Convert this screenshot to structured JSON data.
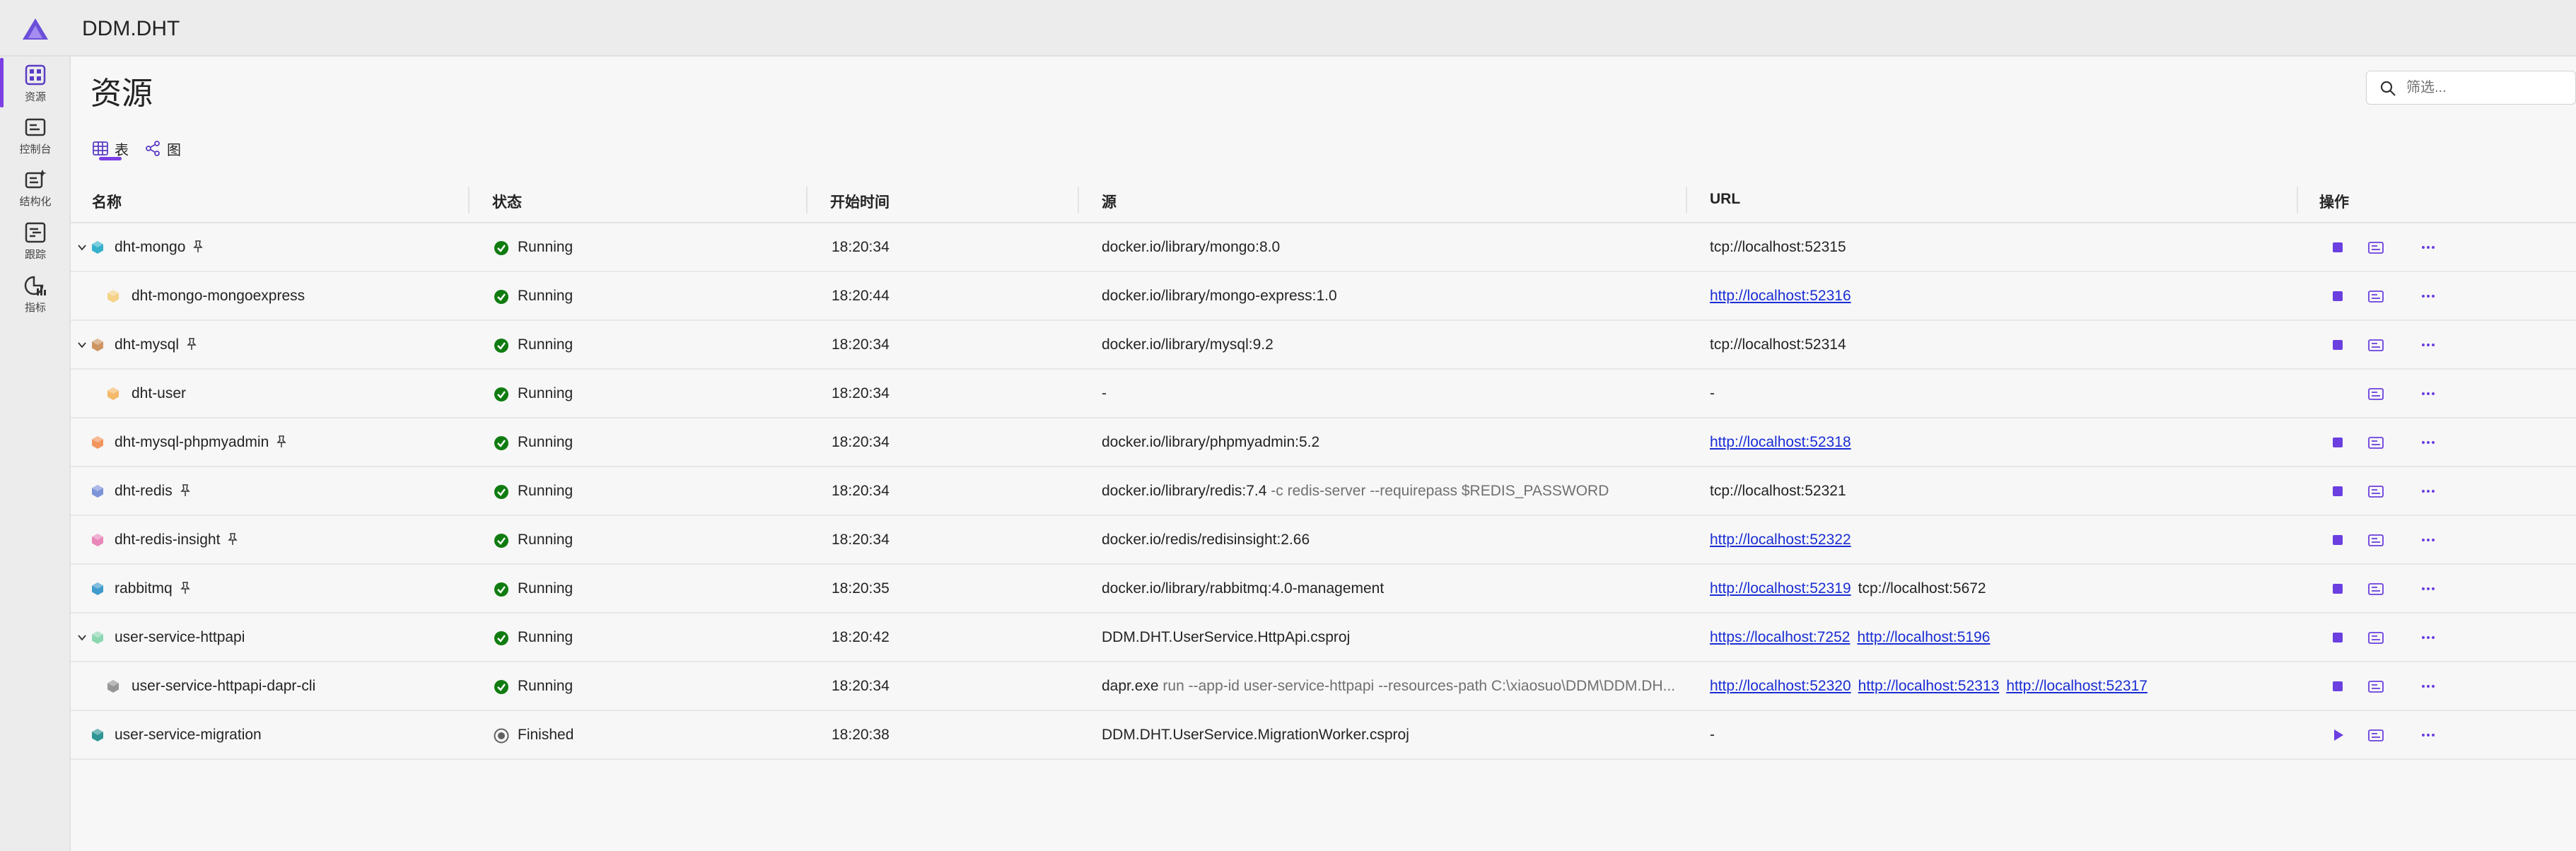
{
  "app": {
    "title": "DDM.DHT"
  },
  "sidebar": {
    "items": [
      {
        "label": "资源",
        "icon": "resources-grid-icon",
        "active": true
      },
      {
        "label": "控制台",
        "icon": "console-icon",
        "active": false
      },
      {
        "label": "结构化",
        "icon": "structured-logs-icon",
        "active": false
      },
      {
        "label": "跟踪",
        "icon": "traces-icon",
        "active": false
      },
      {
        "label": "指标",
        "icon": "metrics-icon",
        "active": false
      }
    ]
  },
  "page": {
    "title": "资源"
  },
  "filter": {
    "placeholder": "筛选..."
  },
  "view_tabs": [
    {
      "label": "表",
      "active": true
    },
    {
      "label": "图",
      "active": false
    }
  ],
  "table": {
    "columns": [
      "名称",
      "状态",
      "开始时间",
      "源",
      "URL",
      "操作"
    ],
    "rows": [
      {
        "name": "dht-mongo",
        "expandable": true,
        "child": false,
        "pinned": true,
        "icon_color": "#1fa9c7",
        "status": "Running",
        "start": "18:20:34",
        "source": "docker.io/library/mongo:8.0",
        "source_args": "",
        "urls": [
          {
            "text": "tcp://localhost:52315",
            "link": false
          }
        ],
        "stop": true
      },
      {
        "name": "dht-mongo-mongoexpress",
        "expandable": false,
        "child": true,
        "pinned": false,
        "icon_color": "#f3cd7a",
        "status": "Running",
        "start": "18:20:44",
        "source": "docker.io/library/mongo-express:1.0",
        "source_args": "",
        "urls": [
          {
            "text": "http://localhost:52316",
            "link": true
          }
        ],
        "stop": true
      },
      {
        "name": "dht-mysql",
        "expandable": true,
        "child": false,
        "pinned": true,
        "icon_color": "#c98a52",
        "status": "Running",
        "start": "18:20:34",
        "source": "docker.io/library/mysql:9.2",
        "source_args": "",
        "urls": [
          {
            "text": "tcp://localhost:52314",
            "link": false
          }
        ],
        "stop": true
      },
      {
        "name": "dht-user",
        "expandable": false,
        "child": true,
        "pinned": false,
        "icon_color": "#f3b25a",
        "status": "Running",
        "start": "18:20:34",
        "source": "-",
        "source_args": "",
        "urls": [
          {
            "text": "-",
            "link": false
          }
        ],
        "stop": false
      },
      {
        "name": "dht-mysql-phpmyadmin",
        "expandable": false,
        "child": false,
        "pinned": true,
        "icon_color": "#f08a4b",
        "status": "Running",
        "start": "18:20:34",
        "source": "docker.io/library/phpmyadmin:5.2",
        "source_args": "",
        "urls": [
          {
            "text": "http://localhost:52318",
            "link": true
          }
        ],
        "stop": true
      },
      {
        "name": "dht-redis",
        "expandable": false,
        "child": false,
        "pinned": true,
        "icon_color": "#6f88d6",
        "status": "Running",
        "start": "18:20:34",
        "source": "docker.io/library/redis:7.4",
        "source_args": "-c redis-server --requirepass $REDIS_PASSWORD",
        "urls": [
          {
            "text": "tcp://localhost:52321",
            "link": false
          }
        ],
        "stop": true
      },
      {
        "name": "dht-redis-insight",
        "expandable": false,
        "child": false,
        "pinned": true,
        "icon_color": "#e57ab3",
        "status": "Running",
        "start": "18:20:34",
        "source": "docker.io/redis/redisinsight:2.66",
        "source_args": "",
        "urls": [
          {
            "text": "http://localhost:52322",
            "link": true
          }
        ],
        "stop": true
      },
      {
        "name": "rabbitmq",
        "expandable": false,
        "child": false,
        "pinned": true,
        "icon_color": "#2b8fc7",
        "status": "Running",
        "start": "18:20:35",
        "source": "docker.io/library/rabbitmq:4.0-management",
        "source_args": "",
        "urls": [
          {
            "text": "http://localhost:52319",
            "link": true
          },
          {
            "text": "tcp://localhost:5672",
            "link": false
          }
        ],
        "stop": true
      },
      {
        "name": "user-service-httpapi",
        "expandable": true,
        "child": false,
        "pinned": false,
        "icon_color": "#7fd3a8",
        "status": "Running",
        "start": "18:20:42",
        "source": "DDM.DHT.UserService.HttpApi.csproj",
        "source_args": "",
        "urls": [
          {
            "text": "https://localhost:7252",
            "link": true
          },
          {
            "text": "http://localhost:5196",
            "link": true
          }
        ],
        "stop": true
      },
      {
        "name": "user-service-httpapi-dapr-cli",
        "expandable": false,
        "child": true,
        "pinned": false,
        "icon_color": "#8c8c8c",
        "status": "Running",
        "start": "18:20:34",
        "source": "dapr.exe",
        "source_args": "run --app-id user-service-httpapi --resources-path C:\\xiaosuo\\DDM\\DDM.DH...",
        "urls": [
          {
            "text": "http://localhost:52320",
            "link": true
          },
          {
            "text": "http://localhost:52313",
            "link": true
          },
          {
            "text": "http://localhost:52317",
            "link": true
          }
        ],
        "stop": true
      },
      {
        "name": "user-service-migration",
        "expandable": false,
        "child": false,
        "pinned": false,
        "icon_color": "#1a8a8a",
        "status": "Finished",
        "start": "18:20:38",
        "source": "DDM.DHT.UserService.MigrationWorker.csproj",
        "source_args": "",
        "urls": [
          {
            "text": "-",
            "link": false
          }
        ],
        "stop": false,
        "play": true
      }
    ]
  },
  "colors": {
    "accent": "#7b3fe4",
    "running": "#107c10",
    "finished": "#616161",
    "link": "#1a2dd4"
  }
}
